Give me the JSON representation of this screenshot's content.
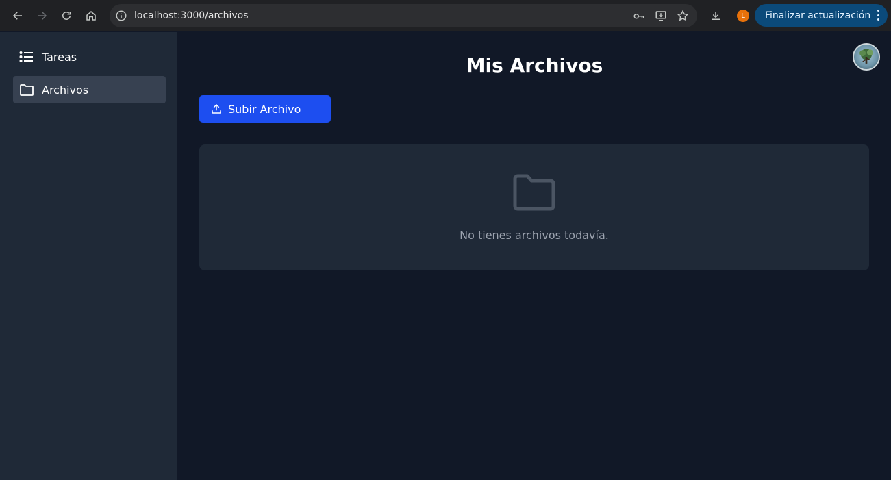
{
  "browser": {
    "url": "localhost:3000/archivos",
    "profile_initial": "L",
    "update_label": "Finalizar actualización"
  },
  "sidebar": {
    "items": [
      {
        "label": "Tareas",
        "icon": "list-icon",
        "active": false
      },
      {
        "label": "Archivos",
        "icon": "folder-icon",
        "active": true
      }
    ]
  },
  "main": {
    "title": "Mis Archivos",
    "upload_label": "Subir Archivo",
    "empty_message": "No tienes archivos todavía."
  },
  "colors": {
    "background": "#111827",
    "sidebar": "#1f2937",
    "primary_button": "#1d4ef0",
    "update_button": "#0b4a7a"
  }
}
